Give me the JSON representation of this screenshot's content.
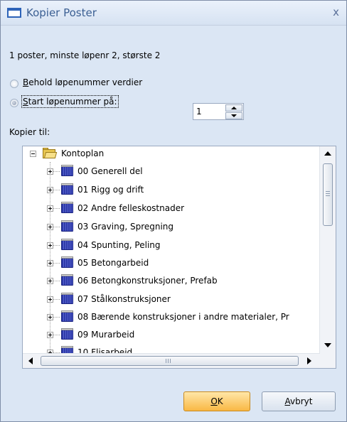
{
  "window": {
    "title": "Kopier Poster",
    "close_glyph": "x"
  },
  "info": {
    "text": "1 poster, minste løpenr 2, største 2"
  },
  "radios": {
    "keep": {
      "label_accel": "B",
      "label_rest": "ehold løpenummer verdier",
      "checked": false
    },
    "start": {
      "label_accel": "S",
      "label_rest": "tart løpenummer på:",
      "checked": true
    }
  },
  "spinner": {
    "value": "1"
  },
  "copy_to": {
    "label": "Kopier til:"
  },
  "tree": {
    "root": {
      "label": "Kontoplan",
      "expanded": true,
      "icon": "folder-open-icon"
    },
    "items": [
      {
        "label": "00 Generell del"
      },
      {
        "label": "01 Rigg og drift"
      },
      {
        "label": "02 Andre felleskostnader"
      },
      {
        "label": "03 Graving, Spregning"
      },
      {
        "label": "04 Spunting, Peling"
      },
      {
        "label": "05 Betongarbeid"
      },
      {
        "label": "06 Betongkonstruksjoner, Prefab"
      },
      {
        "label": "07 Stålkonstruksjoner"
      },
      {
        "label": "08 Bærende konstruksjoner i andre materialer, Pr"
      },
      {
        "label": "09 Murarbeid"
      },
      {
        "label": "10 Flisarbeid"
      }
    ]
  },
  "buttons": {
    "ok": {
      "accel": "O",
      "rest": "K"
    },
    "cancel": {
      "accel": "A",
      "rest": "vbryt"
    }
  },
  "colors": {
    "dialog_bg": "#dbe6f4",
    "ok_button": "#f9b844",
    "tree_item_icon": "#2e3aa8"
  }
}
